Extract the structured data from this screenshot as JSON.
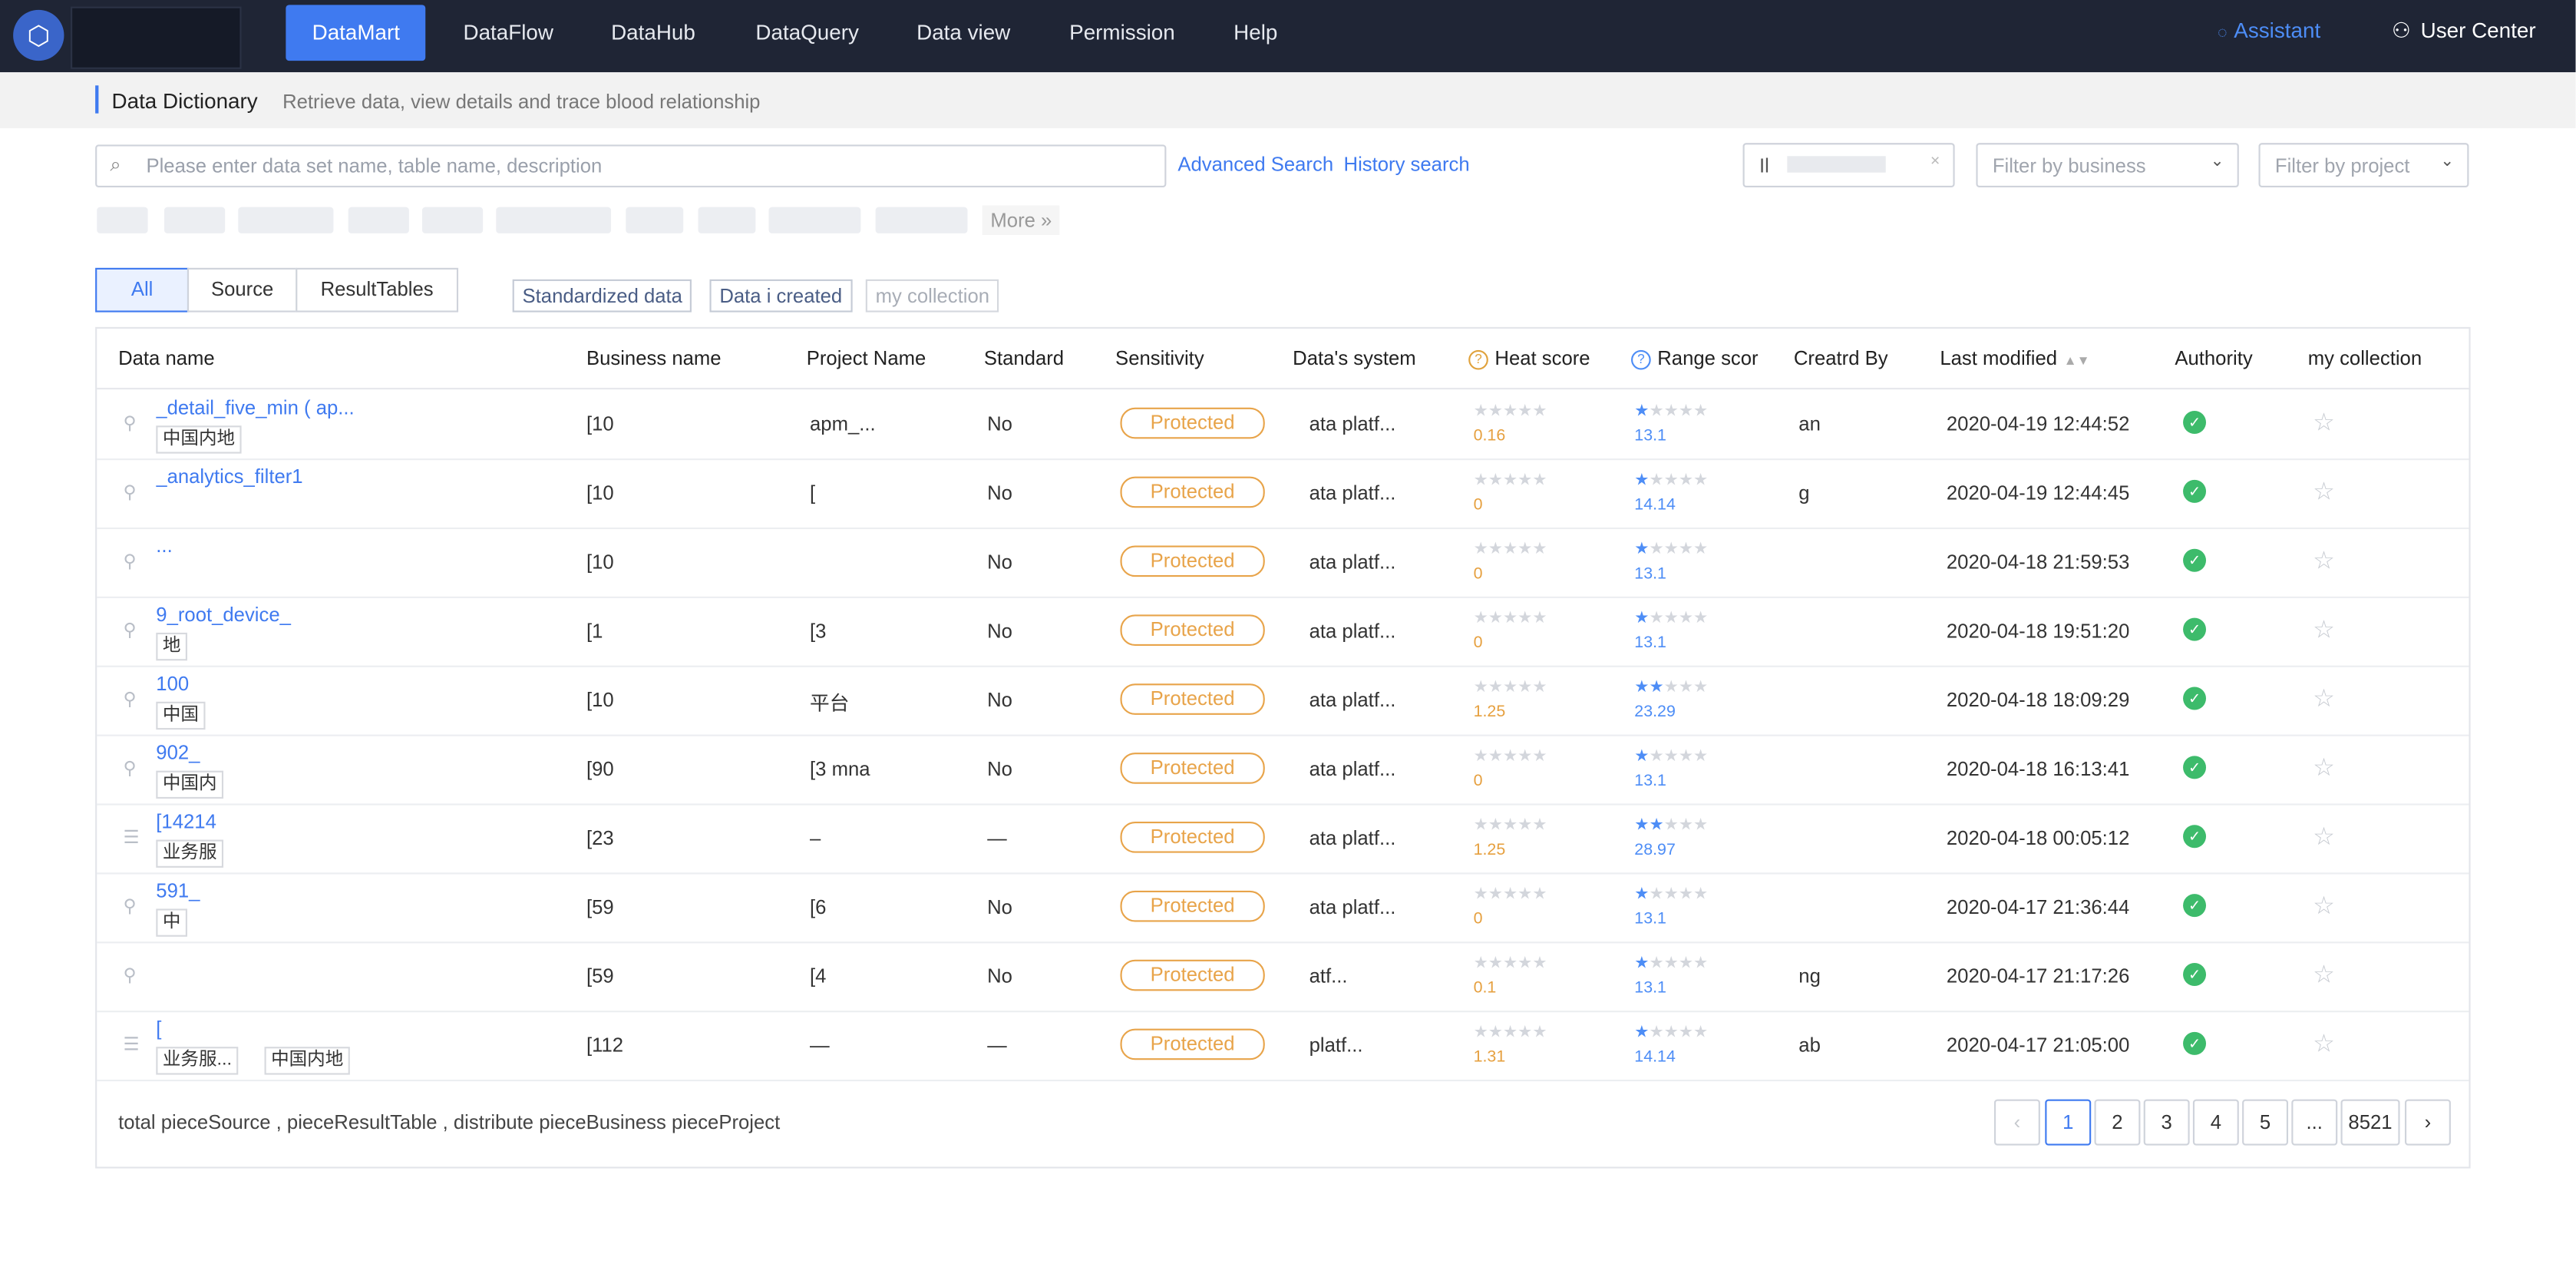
{
  "nav": {
    "items": [
      "DataMart",
      "DataFlow",
      "DataHub",
      "DataQuery",
      "Data view",
      "Permission",
      "Help"
    ],
    "assistant": "Assistant",
    "user_center": "User Center"
  },
  "breadcrumb": {
    "title": "Data Dictionary",
    "subtitle": "Retrieve data, view details and trace blood relationship"
  },
  "search": {
    "placeholder": "Please enter data set name, table name, description",
    "advanced": "Advanced Search",
    "history": "History search",
    "filter_value": "Il",
    "business_placeholder": "Filter by business",
    "project_placeholder": "Filter by project"
  },
  "tags": {
    "more": "More »"
  },
  "filters": {
    "segments": [
      "All",
      "Source",
      "ResultTables"
    ],
    "standardized": "Standardized data",
    "created": "Data i created",
    "collection": "my collection"
  },
  "table": {
    "headers": [
      "Data name",
      "Business name",
      "Project Name",
      "Standard",
      "Sensitivity",
      "Data's system",
      "Heat score",
      "Range scor",
      "Creatrd By",
      "Last modified",
      "Authority",
      "my collection"
    ],
    "rows": [
      {
        "name": "_detail_five_min ( ap...",
        "tag": "中国内地",
        "tag2": "",
        "business": "[10",
        "project": "apm_...",
        "standard": "No",
        "sensitivity": "Protected",
        "system": "ata platf...",
        "heat": "0.16",
        "range": "13.1",
        "range_stars": 1,
        "creator": "an",
        "modified": "2020-04-19 12:44:52"
      },
      {
        "name": "_analytics_filter1",
        "tag": "",
        "tag2": "",
        "business": "[10",
        "project": "[",
        "standard": "No",
        "sensitivity": "Protected",
        "system": "ata platf...",
        "heat": "0",
        "range": "14.14",
        "range_stars": 1,
        "creator": "g",
        "modified": "2020-04-19 12:44:45"
      },
      {
        "name": "...",
        "tag": "",
        "tag2": "",
        "business": "[10",
        "project": "",
        "standard": "No",
        "sensitivity": "Protected",
        "system": "ata platf...",
        "heat": "0",
        "range": "13.1",
        "range_stars": 1,
        "creator": "",
        "modified": "2020-04-18 21:59:53"
      },
      {
        "name": "9_root_device_",
        "tag": "地",
        "tag2": "",
        "business": "[1",
        "project": "[3",
        "standard": "No",
        "sensitivity": "Protected",
        "system": "ata platf...",
        "heat": "0",
        "range": "13.1",
        "range_stars": 1,
        "creator": "",
        "modified": "2020-04-18 19:51:20"
      },
      {
        "name": "100",
        "tag": "中国",
        "tag2": "",
        "business": "[10",
        "project": "平台",
        "standard": "No",
        "sensitivity": "Protected",
        "system": "ata platf...",
        "heat": "1.25",
        "range": "23.29",
        "range_stars": 2,
        "creator": "",
        "modified": "2020-04-18 18:09:29"
      },
      {
        "name": "902_",
        "tag": "中国内",
        "tag2": "",
        "business": "[90",
        "project": "[3 mna",
        "standard": "No",
        "sensitivity": "Protected",
        "system": "ata platf...",
        "heat": "0",
        "range": "13.1",
        "range_stars": 1,
        "creator": "",
        "modified": "2020-04-18 16:13:41"
      },
      {
        "name": "[14214",
        "tag": "业务服",
        "tag2": "",
        "business": "[23",
        "project": "–",
        "standard": "—",
        "sensitivity": "Protected",
        "system": "ata platf...",
        "heat": "1.25",
        "range": "28.97",
        "range_stars": 2,
        "creator": "",
        "modified": "2020-04-18 00:05:12"
      },
      {
        "name": "591_",
        "tag": "中",
        "tag2": "",
        "business": "[59",
        "project": "[6",
        "standard": "No",
        "sensitivity": "Protected",
        "system": "ata platf...",
        "heat": "0",
        "range": "13.1",
        "range_stars": 1,
        "creator": "",
        "modified": "2020-04-17 21:36:44"
      },
      {
        "name": "",
        "tag": "",
        "tag2": "",
        "business": "[59",
        "project": "[4",
        "standard": "No",
        "sensitivity": "Protected",
        "system": "atf...",
        "heat": "0.1",
        "range": "13.1",
        "range_stars": 1,
        "creator": "ng",
        "modified": "2020-04-17 21:17:26"
      },
      {
        "name": "[",
        "tag": "业务服...",
        "tag2": "中国内地",
        "business": "[112",
        "project": "—",
        "standard": "—",
        "sensitivity": "Protected",
        "system": "platf...",
        "heat": "1.31",
        "range": "14.14",
        "range_stars": 1,
        "creator": "ab",
        "modified": "2020-04-17 21:05:00"
      }
    ]
  },
  "footer": {
    "total": "total pieceSource , pieceResultTable , distribute pieceBusiness pieceProject",
    "pages": [
      "1",
      "2",
      "3",
      "4",
      "5",
      "...",
      "8521"
    ],
    "prev": "‹",
    "next": "›"
  },
  "colors": {
    "accent": "#3f7af0",
    "nav_bg": "#1f2535",
    "warning": "#e8a44a",
    "success": "#3dbb6b"
  }
}
